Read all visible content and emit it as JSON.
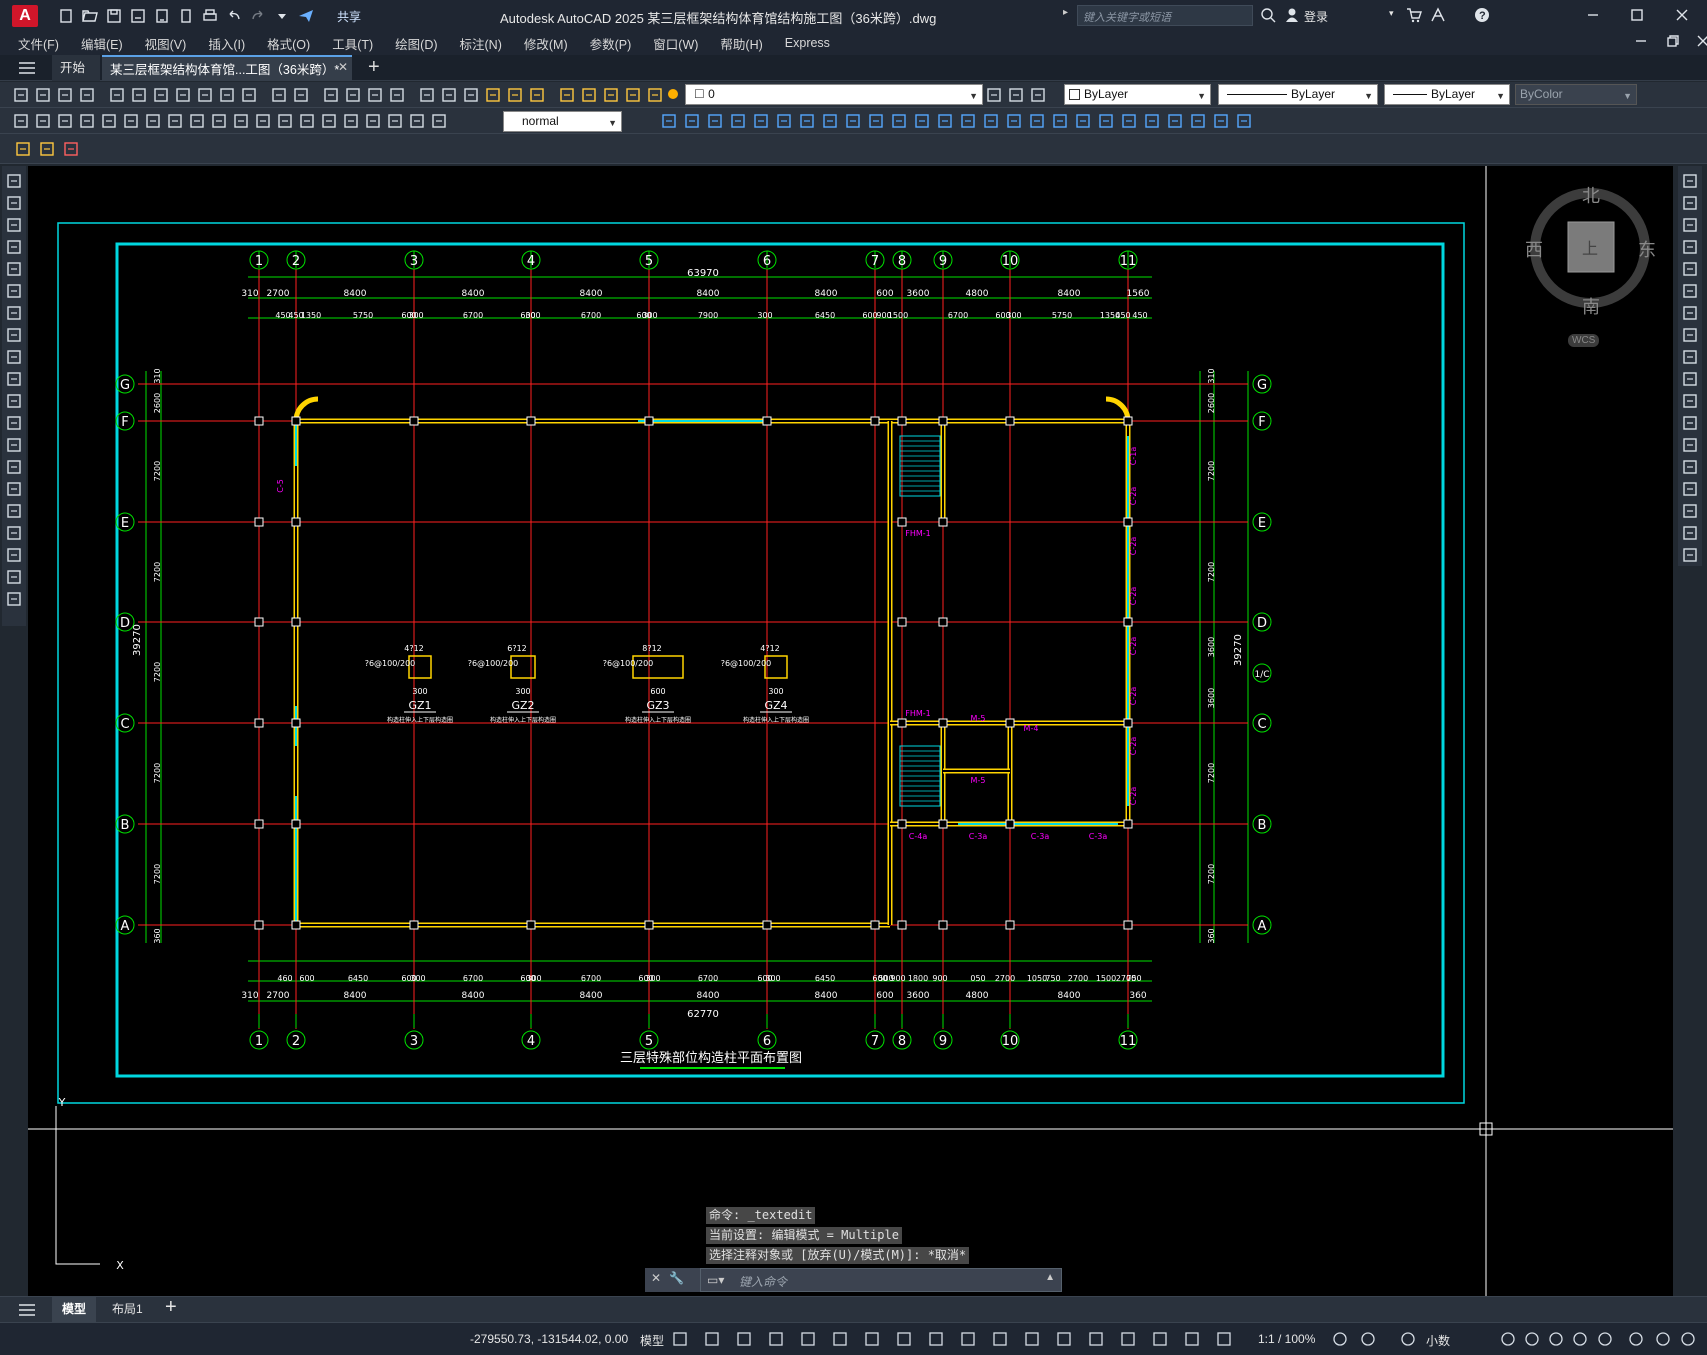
{
  "app": {
    "title": "Autodesk AutoCAD 2025    某三层框架结构体育馆结构施工图（36米跨）.dwg",
    "search_placeholder": "键入关键字或短语",
    "share_label": "共享",
    "login_label": "登录"
  },
  "menu": [
    "文件(F)",
    "编辑(E)",
    "视图(V)",
    "插入(I)",
    "格式(O)",
    "工具(T)",
    "绘图(D)",
    "标注(N)",
    "修改(M)",
    "参数(P)",
    "窗口(W)",
    "帮助(H)",
    "Express"
  ],
  "tabs": {
    "start": "开始",
    "doc": "某三层框架结构体育馆...工图（36米跨）*"
  },
  "toolbar": {
    "layer_value": "0",
    "color": "ByLayer",
    "linetype": "ByLayer",
    "lineweight": "ByLayer",
    "plotstyle": "ByColor",
    "dimstyle": "normal"
  },
  "viewcube": {
    "north": "北",
    "south": "南",
    "east": "东",
    "west": "西",
    "top": "上",
    "wcs": "WCS"
  },
  "drawing": {
    "title": "三层特殊部位构造柱平面布置图",
    "axes_x": [
      "1",
      "2",
      "3",
      "4",
      "5",
      "6",
      "7",
      "8",
      "9",
      "10",
      "11"
    ],
    "axes_y": [
      "G",
      "F",
      "E",
      "D",
      "C",
      "B",
      "A"
    ],
    "axis_extra": "1/C",
    "top_total": "63970",
    "bottom_total": "62770",
    "left_total": "39270",
    "right_total": "39270",
    "top_dims_row1": [
      "310",
      "2700",
      "8400",
      "8400",
      "8400",
      "8400",
      "8400",
      "600",
      "3600",
      "4800",
      "8400",
      "1560"
    ],
    "top_dims_row2": [
      "450",
      "450",
      "1350",
      "5750",
      "600",
      "300",
      "6700",
      "600",
      "300",
      "6700",
      "600",
      "300",
      "7900",
      "300",
      "6450",
      "600",
      "900",
      "1500",
      "6700",
      "600",
      "300",
      "5750",
      "1350",
      "450",
      "450"
    ],
    "bottom_dims_row1": [
      "310",
      "2700",
      "8400",
      "8400",
      "8400",
      "8400",
      "8400",
      "600",
      "3600",
      "4800",
      "8400",
      "360"
    ],
    "bottom_dims_row2": [
      "460",
      "600",
      "6450",
      "600",
      "300",
      "6700",
      "600",
      "300",
      "6700",
      "600",
      "300",
      "6700",
      "600",
      "300",
      "6450",
      "600",
      "500",
      "900",
      "1800",
      "900",
      "050",
      "2700",
      "1050",
      "750",
      "2700",
      "1500",
      "2700",
      "750"
    ],
    "left_dims": [
      "310",
      "2600",
      "7200",
      "7200",
      "7200",
      "7200",
      "7200",
      "360"
    ],
    "right_dims": [
      "310",
      "2600",
      "7200",
      "7200",
      "3600",
      "3600",
      "7200",
      "7200",
      "360"
    ],
    "columns": [
      {
        "name": "GZ1",
        "spec": "4?12",
        "stir": "?6@100/200",
        "w": "300",
        "note": "构造柱伸入上下层构造圈"
      },
      {
        "name": "GZ2",
        "spec": "6?12",
        "stir": "?6@100/200",
        "w": "300",
        "note": "构造柱伸入上下层构造圈"
      },
      {
        "name": "GZ3",
        "spec": "8?12",
        "stir": "?6@100/200",
        "w": "600",
        "note": "构造柱伸入上下层构造圈"
      },
      {
        "name": "GZ4",
        "spec": "4?12",
        "stir": "?6@100/200",
        "w": "300",
        "note": "构造柱伸入上下层构造圈"
      }
    ],
    "doors": [
      "FHM-1",
      "FHM-1",
      "M-5",
      "M-4",
      "M-5"
    ],
    "windows": [
      "C-5",
      "C-1a",
      "C-2a",
      "C-2a",
      "C-2a",
      "C-2a",
      "C-2a",
      "C-2a",
      "C-2a",
      "C-4a",
      "C-3a",
      "C-3a",
      "C-3a"
    ]
  },
  "command": {
    "line1": "命令: _textedit",
    "line2": "当前设置: 编辑模式 = Multiple",
    "line3": "选择注释对象或 [放弃(U)/模式(M)]: *取消*",
    "placeholder": "键入命令"
  },
  "layout_tabs": [
    "模型",
    "布局1"
  ],
  "status": {
    "coords": "-279550.73, -131544.02, 0.00",
    "model": "模型",
    "scale": "1:1 / 100%",
    "units": "小数"
  },
  "colors": {
    "grid": "#ff2020",
    "dim": "#00e000",
    "wall": "#ffd400",
    "frame": "#00d8e0",
    "text": "#ffffff",
    "magenta": "#ff00ff"
  }
}
